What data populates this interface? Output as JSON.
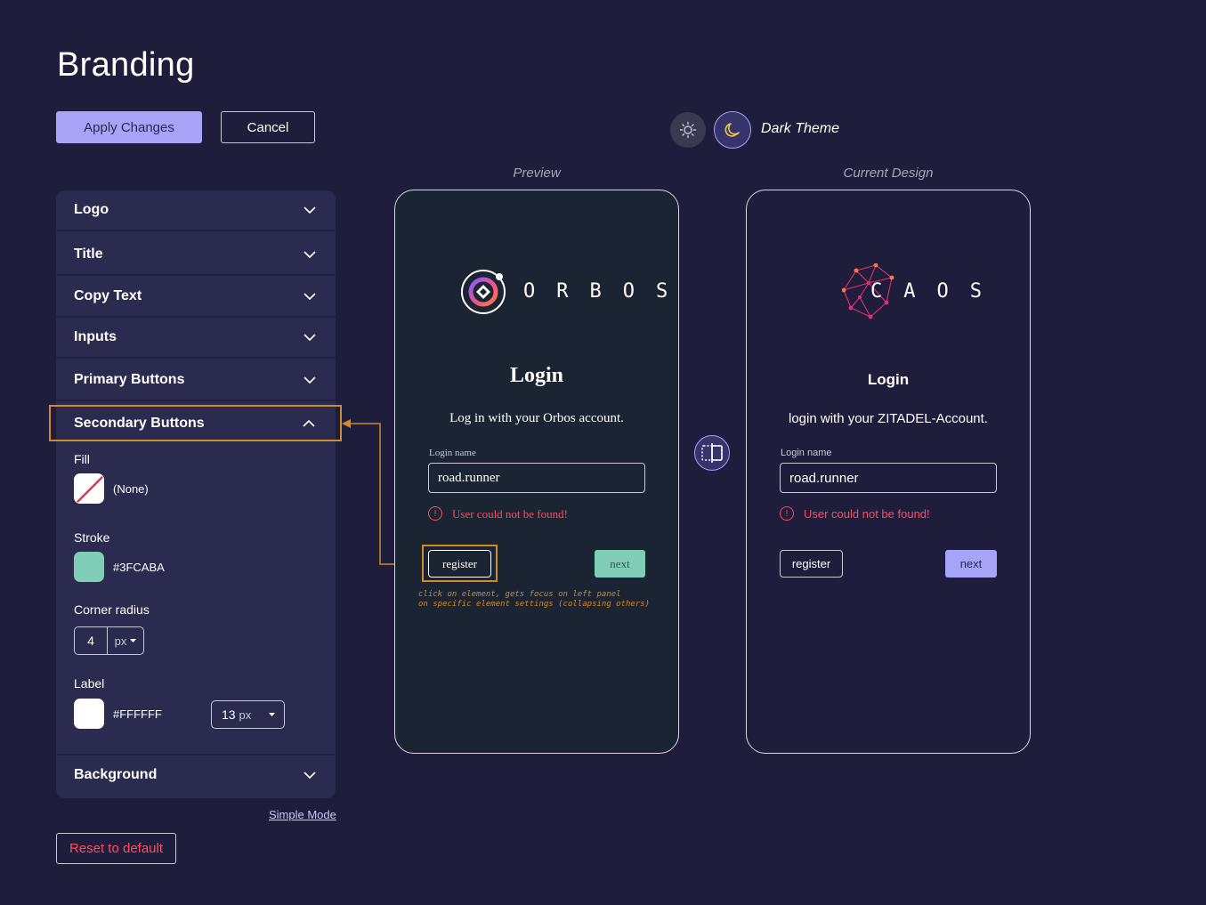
{
  "page": {
    "title": "Branding"
  },
  "toolbar": {
    "apply_label": "Apply Changes",
    "cancel_label": "Cancel"
  },
  "theme": {
    "active_label": "Dark Theme"
  },
  "panel": {
    "sections": {
      "logo": "Logo",
      "title": "Title",
      "copy_text": "Copy Text",
      "inputs": "Inputs",
      "primary_buttons": "Primary Buttons",
      "secondary_buttons": "Secondary Buttons",
      "background": "Background"
    },
    "secondary": {
      "fill_label": "Fill",
      "fill_value": "(None)",
      "stroke_label": "Stroke",
      "stroke_value": "#3FCABA",
      "stroke_color": "#7fcdb6",
      "radius_label": "Corner radius",
      "radius_value": "4",
      "radius_unit": "px",
      "label_label": "Label",
      "label_color_value": "#FFFFFF",
      "label_size_value": "13",
      "label_size_unit": "px"
    },
    "simple_mode": "Simple Mode",
    "reset_label": "Reset to default"
  },
  "preview": {
    "heading": "Preview",
    "logo_text": "ORBOS",
    "login_title": "Login",
    "login_subtitle": "Log in with your Orbos account.",
    "input_label": "Login name",
    "input_value": "road.runner",
    "error_text": "User could not be found!",
    "register_label": "register",
    "next_label": "next",
    "annotation_line1": "click on element, gets focus on left panel",
    "annotation_line2": "on specific element settings (collapsing others)"
  },
  "current": {
    "heading": "Current Design",
    "logo_text": "CAOS",
    "login_title": "Login",
    "login_subtitle": "login with your ZITADEL-Account.",
    "input_label": "Login name",
    "input_value": "road.runner",
    "error_text": "User could not be found!",
    "register_label": "register",
    "next_label": "next"
  },
  "colors": {
    "background": "#1f1d3c",
    "panel": "#2b2a4f",
    "accent": "#a7a3f6",
    "highlight": "#d28a2a",
    "error": "#ff4d5e",
    "teal": "#7fcdb6"
  }
}
